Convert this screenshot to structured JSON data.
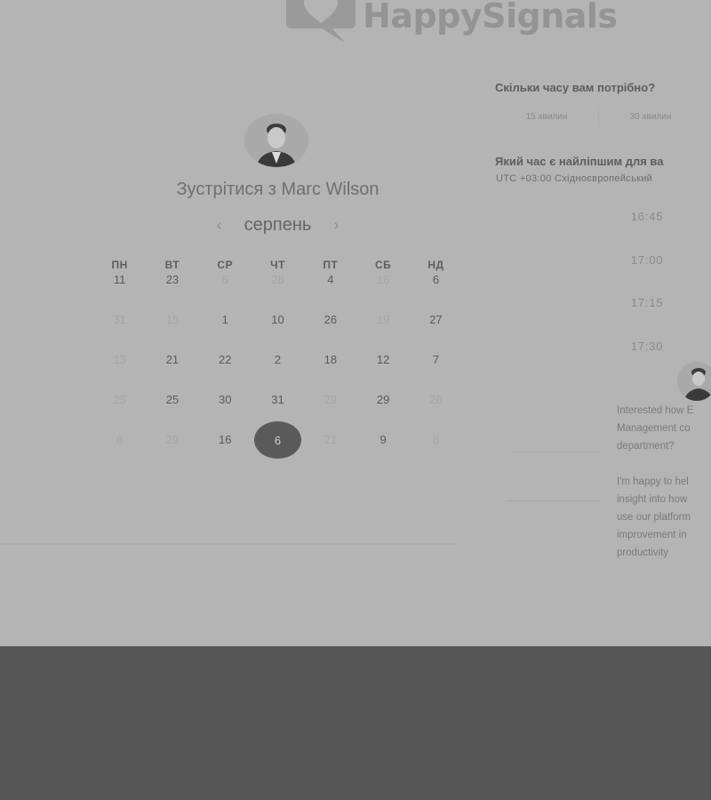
{
  "brand": {
    "name": "HappySignals",
    "logo_icon": "heart-speech-bubble-icon"
  },
  "booking": {
    "meet_title": "Зустрітися з Marc Wilson",
    "month": "серпень",
    "prev_icon": "chevron-left-icon",
    "next_icon": "chevron-right-icon"
  },
  "calendar": {
    "weekdays": [
      "ПН",
      "ВТ",
      "СР",
      "ЧТ",
      "ПТ",
      "СБ",
      "НД"
    ],
    "rows": [
      [
        {
          "d": "11",
          "f": false
        },
        {
          "d": "23",
          "f": false
        },
        {
          "d": "6",
          "f": true
        },
        {
          "d": "28",
          "f": true
        },
        {
          "d": "4",
          "f": false
        },
        {
          "d": "16",
          "f": true
        },
        {
          "d": "6",
          "f": false
        }
      ],
      [
        {
          "d": "31",
          "f": true
        },
        {
          "d": "15",
          "f": true
        },
        {
          "d": "1",
          "f": false
        },
        {
          "d": "10",
          "f": false
        },
        {
          "d": "26",
          "f": false
        },
        {
          "d": "19",
          "f": true
        },
        {
          "d": "27",
          "f": false
        }
      ],
      [
        {
          "d": "13",
          "f": true
        },
        {
          "d": "21",
          "f": false
        },
        {
          "d": "22",
          "f": false
        },
        {
          "d": "2",
          "f": false
        },
        {
          "d": "18",
          "f": false
        },
        {
          "d": "12",
          "f": false
        },
        {
          "d": "7",
          "f": false
        }
      ],
      [
        {
          "d": "25",
          "f": true
        },
        {
          "d": "25",
          "f": false
        },
        {
          "d": "30",
          "f": false
        },
        {
          "d": "31",
          "f": false
        },
        {
          "d": "29",
          "f": true
        },
        {
          "d": "29",
          "f": false
        },
        {
          "d": "26",
          "f": true
        }
      ],
      [
        {
          "d": "6",
          "f": true
        },
        {
          "d": "29",
          "f": true
        },
        {
          "d": "16",
          "f": false
        },
        {
          "d": "6",
          "f": false,
          "sel": true
        },
        {
          "d": "21",
          "f": true
        },
        {
          "d": "9",
          "f": false
        },
        {
          "d": "8",
          "f": true
        }
      ]
    ]
  },
  "duration": {
    "question": "Скільки часу вам потрібно?",
    "options": [
      "15 хвилин",
      "30 хвилин"
    ]
  },
  "time": {
    "question": "Який час є найліпшим для ва",
    "timezone": "UTC +03:00 Східноєвропейський",
    "slots": [
      "16:45",
      "17:00",
      "17:15",
      "17:30"
    ]
  },
  "chat": {
    "lines1": [
      "Interested how E",
      "Management co",
      "department?"
    ],
    "lines2": [
      "I'm happy to hel",
      "insight into how",
      "use our platform",
      "improvement in",
      "productivity"
    ]
  },
  "colors": {
    "overlay": "#b4b4b4",
    "footer": "#565656",
    "selected_day": "#5a5a5a"
  }
}
